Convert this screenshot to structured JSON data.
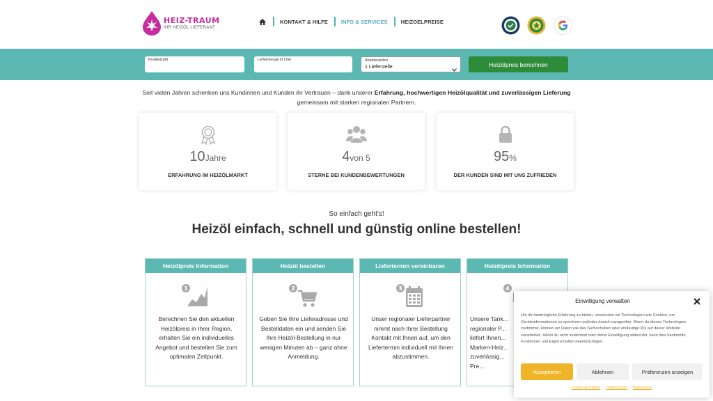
{
  "header": {
    "logo_title": "HEIZ-TRAUM",
    "logo_subtitle": "IHR HEIZÖL LIEFERANT",
    "nav": {
      "home_icon": "home-icon",
      "items": [
        {
          "label": "KONTAKT & HILFE"
        },
        {
          "label": "INFO & SERVICES",
          "active": true
        },
        {
          "label": "HEIZOELPREISE"
        }
      ]
    },
    "badges": [
      "seal-badge-icon",
      "award-badge-icon",
      "google-icon"
    ]
  },
  "calculator": {
    "postcode_label": "Postleitzahl",
    "postcode_value": "",
    "quantity_label": "Liefermenge in Liter",
    "quantity_value": "",
    "unloading_label": "Abladestellen",
    "unloading_value": "1 Lieferstelle",
    "submit_label": "Heizölpreis berechnen"
  },
  "intro": {
    "part1": "Seit vielen Jahren schenken uns Kundinnen und Kunden ihr Vertrauen – dank unserer ",
    "bold": "Erfahrung, hochwertigen Heizölqualität und zuverlässigen Lieferung",
    "part2": " gemeinsam mit starken regionalen Partnern."
  },
  "stats": [
    {
      "icon": "award-ribbon-icon",
      "number": "10",
      "unit": "Jahre",
      "caption": "ERFAHRUNG IM HEIZÖLMARKT"
    },
    {
      "icon": "users-group-icon",
      "number": "4",
      "unit": "von 5",
      "caption": "STERNE BEI KUNDENBEWERTUNGEN"
    },
    {
      "icon": "lock-icon",
      "number": "95",
      "unit": "%",
      "caption": "DER KUNDEN SIND MIT UNS ZUFRIEDEN"
    }
  ],
  "how_to": {
    "subheading": "So einfach geht's!",
    "heading": "Heizöl einfach, schnell und günstig online bestellen!"
  },
  "steps": [
    {
      "title": "Heizölpreis Information",
      "number": "1",
      "icon": "chart-icon",
      "text": "Berechnen Sie den aktuellen Heizölpreis in Ihrer Region, erhalten Sie ein individuelles Angebot und bestellen Sie zum optimalen Zeitpunkt."
    },
    {
      "title": "Heizöl bestellen",
      "number": "2",
      "icon": "cart-icon",
      "text": "Geben Sie Ihre Lieferadresse und Bestelldaten ein und senden Sie Ihre Heizöl-Bestellung in nur wenigen Minuten ab – ganz ohne Anmeldung."
    },
    {
      "title": "Liefertermin vereinbaren",
      "number": "3",
      "icon": "calendar-icon",
      "text": "Unser regionaler Lieferpartner nimmt nach Ihrer Bestellung Kontakt mit Ihnen auf, um den Liefertermin individuell mit Ihnen abzustimmen."
    },
    {
      "title": "Heizölpreis Information",
      "number": "4",
      "icon": "truck-icon",
      "text": "Unsere Tank... regionaler P... liefert Ihnen... Marken-Heiz... zuverlässig... Pre..."
    }
  ],
  "consent": {
    "title": "Einwilligung verwalten",
    "body": "Um dir bestmögliche Erfahrung zu bieten, verwenden wir Technologien wie Cookies, um Geräteinformationen zu speichern und/oder darauf zuzugreifen. Wenn du diesen Technologien zustimmst, können wir Daten wie das Surfverhalten oder eindeutige IDs auf dieser Website verarbeiten. Wenn du nicht zustimmst oder deine Einwilligung widerrufst, kann dies bestimmte Funktionen und Eigenschaften beeinträchtigen.",
    "accept": "Akzeptieren",
    "deny": "Ablehnen",
    "preferences": "Präferenzen anzeigen",
    "links": [
      "Cookie-Richtlinie",
      "Datenschutz",
      "Impressum"
    ]
  }
}
